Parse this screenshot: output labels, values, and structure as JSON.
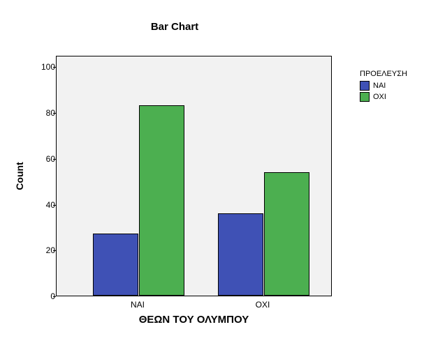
{
  "chart_data": {
    "type": "bar",
    "title": "Bar Chart",
    "xlabel": "ΘΕΩΝ ΤΟΥ ΟΛΥΜΠΟΥ",
    "ylabel": "Count",
    "categories": [
      "ΝΑΙ",
      "ΟΧΙ"
    ],
    "series": [
      {
        "name": "ΝΑΙ",
        "values": [
          27,
          36
        ],
        "color": "#3f51b5"
      },
      {
        "name": "ΟΧΙ",
        "values": [
          83,
          54
        ],
        "color": "#4caf50"
      }
    ],
    "ylim": [
      0,
      105
    ],
    "yticks": [
      0,
      20,
      40,
      60,
      80,
      100
    ],
    "legend_title": "ΠΡΟΕΛΕΥΣΗ",
    "legend_position": "right"
  }
}
